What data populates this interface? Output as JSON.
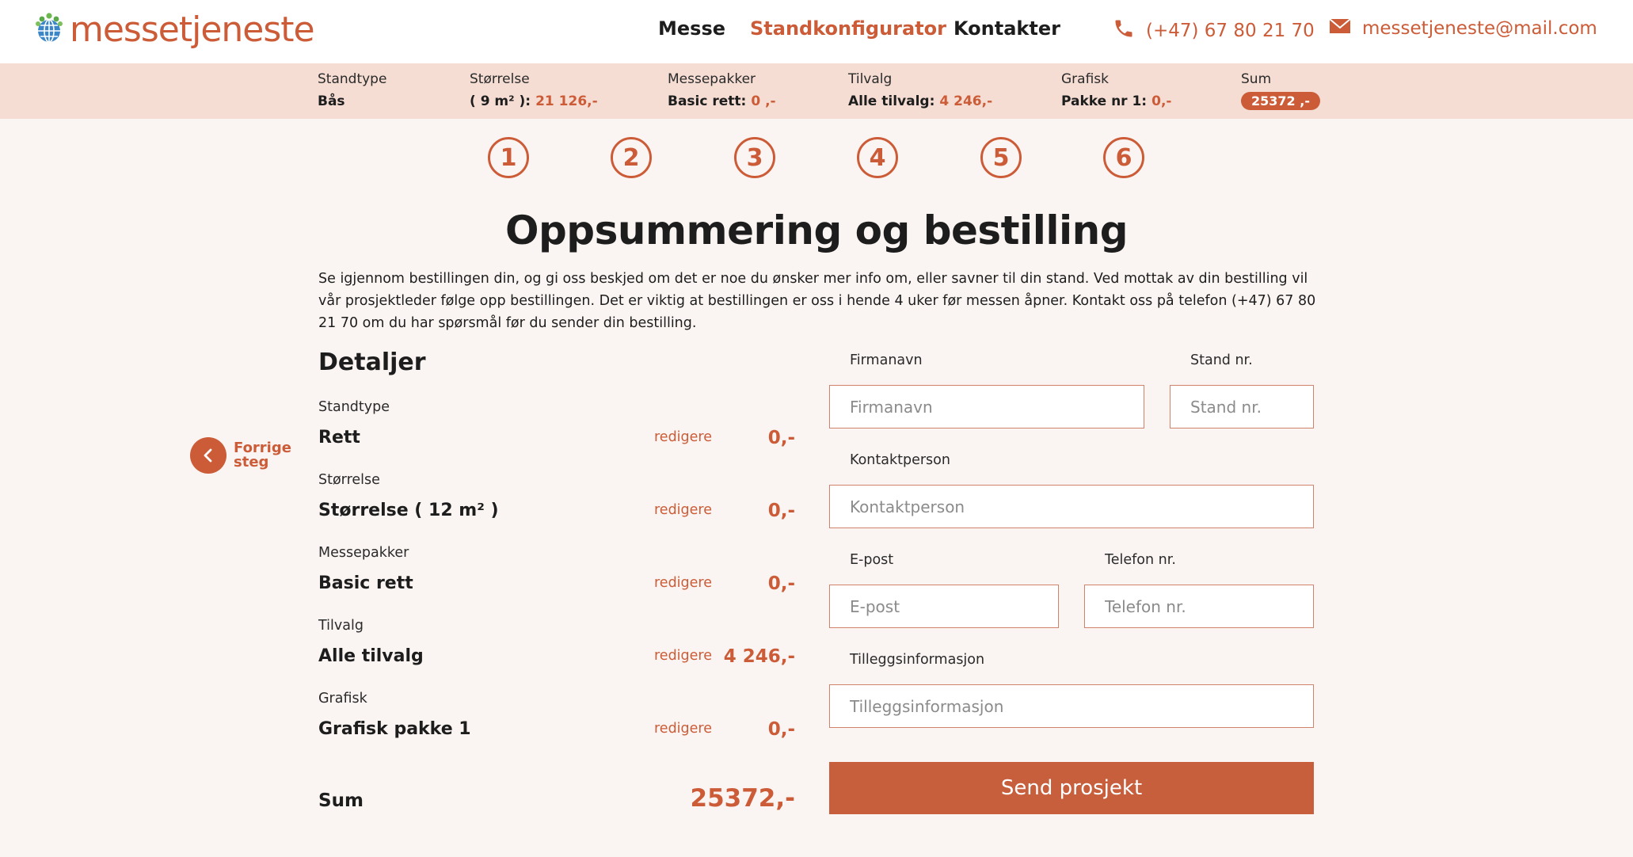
{
  "header": {
    "logo_text": "messetjeneste",
    "nav": [
      "Messe",
      "Standkonfigurator",
      "Kontakter"
    ],
    "phone": "(+47) 67 80 21 70",
    "email": "messetjeneste@mail.com"
  },
  "summary_bar": {
    "standtype": {
      "label": "Standtype",
      "value": "Bås"
    },
    "storrelse": {
      "label": "Størrelse",
      "value": "( 9 m² ):",
      "price": "21 126,-"
    },
    "messepakker": {
      "label": "Messepakker",
      "value": "Basic rett:",
      "price": "0 ,-"
    },
    "tilvalg": {
      "label": "Tilvalg",
      "value": "Alle tilvalg:",
      "price": "4 246,-"
    },
    "grafisk": {
      "label": "Grafisk",
      "value": "Pakke nr 1:",
      "price": "0,-"
    },
    "sum": {
      "label": "Sum",
      "value": "25372 ,-"
    }
  },
  "steps": [
    "1",
    "2",
    "3",
    "4",
    "5",
    "6"
  ],
  "title": "Oppsummering og bestilling",
  "intro": "Se igjennom bestillingen din, og gi oss beskjed om det er noe du ønsker mer info om, eller savner til din stand. Ved mottak av din bestilling vil vår prosjektleder følge opp bestillingen. Det er viktig at bestillingen er oss i hende 4 uker før messen åpner. Kontakt oss på telefon (+47) 67 80 21 70 om du har spørsmål før du sender din bestilling.",
  "back": {
    "label_line1": "Forrige",
    "label_line2": "steg"
  },
  "details": {
    "heading": "Detaljer",
    "edit_label": "redigere",
    "rows": [
      {
        "label": "Standtype",
        "value": "Rett",
        "price": "0,-"
      },
      {
        "label": "Størrelse",
        "value": "Størrelse ( 12 m² )",
        "price": "0,-"
      },
      {
        "label": "Messepakker",
        "value": "Basic rett",
        "price": "0,-"
      },
      {
        "label": "Tilvalg",
        "value": "Alle tilvalg",
        "price": "4 246,-"
      },
      {
        "label": "Grafisk",
        "value": "Grafisk pakke 1",
        "price": "0,-"
      }
    ],
    "sum_label": "Sum",
    "sum_value": "25372,-"
  },
  "form": {
    "firmanavn": {
      "label": "Firmanavn",
      "placeholder": "Firmanavn",
      "value": ""
    },
    "stand_nr": {
      "label": "Stand nr.",
      "placeholder": "Stand nr.",
      "value": ""
    },
    "kontaktperson": {
      "label": "Kontaktperson",
      "placeholder": "Kontaktperson",
      "value": ""
    },
    "epost": {
      "label": "E-post",
      "placeholder": "E-post",
      "value": ""
    },
    "telefon": {
      "label": "Telefon nr.",
      "placeholder": "Telefon nr.",
      "value": ""
    },
    "tillegg": {
      "label": "Tilleggsinformasjon",
      "placeholder": "Tilleggsinformasjon",
      "value": ""
    },
    "submit_label": "Send prosjekt"
  },
  "colors": {
    "accent": "#cc5c38",
    "summary_bar_bg": "#f5ddd3",
    "page_bg": "#faf5f2"
  },
  "icons": [
    "globe-logo-icon",
    "phone-icon",
    "mail-icon",
    "chevron-left-icon"
  ]
}
